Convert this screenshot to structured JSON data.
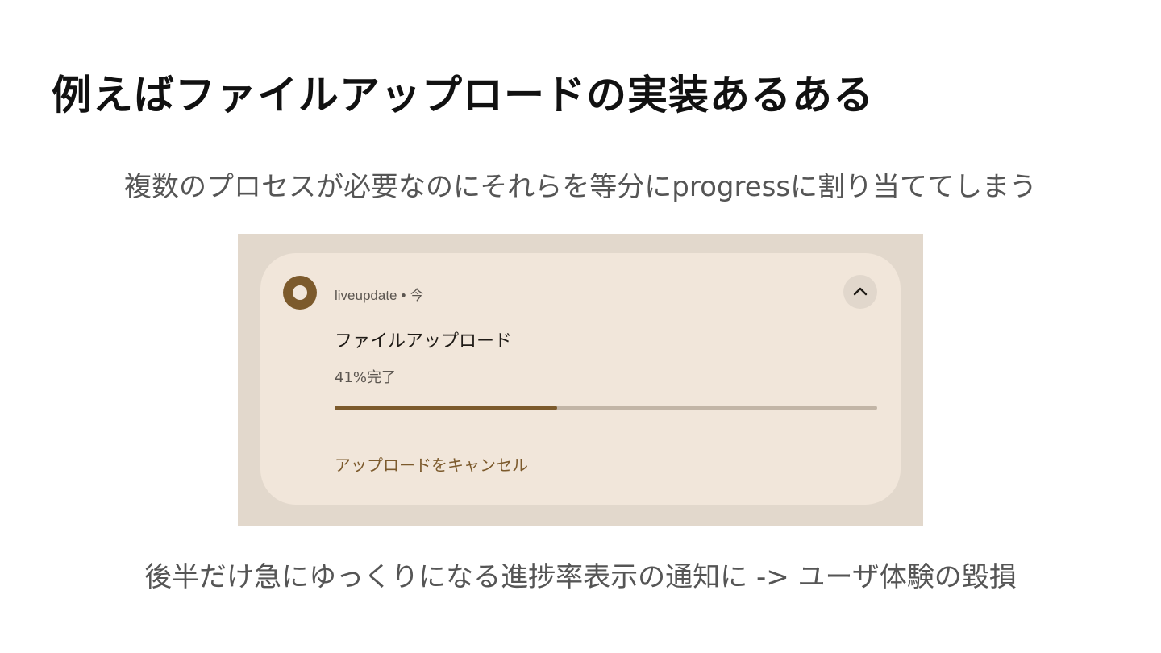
{
  "slide": {
    "title": "例えばファイルアップロードの実装あるある",
    "subtitle": "複数のプロセスが必要なのにそれらを等分にprogressに割り当ててしまう",
    "caption": "後半だけ急にゆっくりになる進捗率表示の通知に -> ユーザ体験の毀損"
  },
  "notification": {
    "app_name": "liveupdate",
    "separator": "•",
    "time": "今",
    "title": "ファイルアップロード",
    "text": "41%完了",
    "progress": 0.41,
    "action_label": "アップロードをキャンセル",
    "app_icon": "app-ring-icon",
    "expand_icon": "chevron-up-icon"
  },
  "colors": {
    "accent": "#7c5a2c",
    "card_background": "#f1e6da",
    "frame_background": "#e2d8cc",
    "progress_track": "#c2b5a6"
  }
}
